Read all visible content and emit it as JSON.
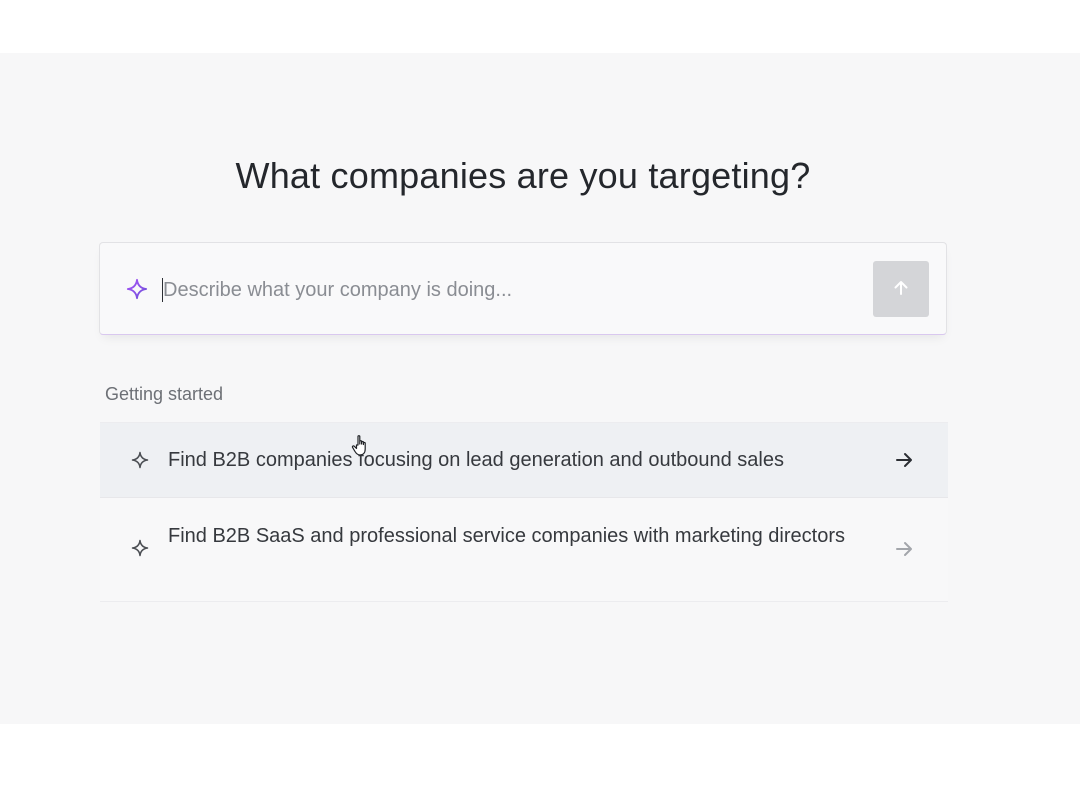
{
  "page": {
    "title": "What companies are you targeting?"
  },
  "prompt": {
    "placeholder": "Describe what your company is doing...",
    "value": "",
    "leading_icon": "sparkle-icon",
    "send_icon": "arrow-up-icon"
  },
  "suggestions_section": {
    "label": "Getting started",
    "items": [
      {
        "text": "Find B2B companies focusing on lead generation and outbound sales",
        "icon": "sparkle-icon",
        "trailing_icon": "arrow-right-icon",
        "state": "hovered"
      },
      {
        "text": "Find B2B SaaS and professional service companies with marketing directors",
        "icon": "sparkle-icon",
        "trailing_icon": "arrow-right-icon",
        "state": "default"
      }
    ]
  },
  "colors": {
    "accent": "#8b5cf6",
    "send_button_disabled": "#d4d5d8",
    "hover_row": "#eef0f3"
  },
  "cursor": {
    "icon": "hand-pointer-icon"
  }
}
